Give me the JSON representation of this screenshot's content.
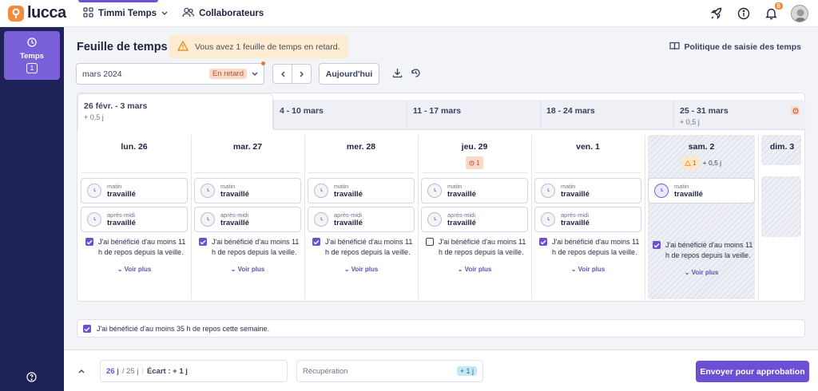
{
  "app": {
    "logo_text": "lucca",
    "module": "Timmi Temps",
    "nav_collab": "Collaborateurs",
    "notifications_count": "6",
    "brand_color": "#6d4fd6"
  },
  "sidebar": {
    "item_label": "Temps",
    "item_count": "1"
  },
  "page": {
    "title": "Feuille de temps",
    "alert": "Vous avez 1 feuille de temps en retard.",
    "policy": "Politique de saisie des temps",
    "month": "mars 2024",
    "month_status": "En retard",
    "today": "Aujourd'hui"
  },
  "weeks": [
    {
      "label": "26 févr. - 3 mars",
      "sub": "+ 0,5 j"
    },
    {
      "label": "4 - 10 mars",
      "sub": ""
    },
    {
      "label": "11 - 17 mars",
      "sub": ""
    },
    {
      "label": "18 - 24 mars",
      "sub": ""
    },
    {
      "label": "25 - 31 mars",
      "sub": "+ 0,5 j"
    }
  ],
  "days": [
    {
      "name": "lun. 26",
      "am_top": "matin",
      "am": "travaillé",
      "pm_top": "après-midi",
      "pm": "travaillé"
    },
    {
      "name": "mar. 27",
      "am_top": "matin",
      "am": "travaillé",
      "pm_top": "après-midi",
      "pm": "travaillé"
    },
    {
      "name": "mer. 28",
      "am_top": "matin",
      "am": "travaillé",
      "pm_top": "après-midi",
      "pm": "travaillé"
    },
    {
      "name": "jeu. 29",
      "chip": "1",
      "am_top": "matin",
      "am": "travaillé",
      "pm_top": "après-midi",
      "pm": "travaillé"
    },
    {
      "name": "ven. 1",
      "am_top": "matin",
      "am": "travaillé",
      "pm_top": "après-midi",
      "pm": "travaillé"
    },
    {
      "name": "sam. 2",
      "chip": "1",
      "extra": "+ 0,5 j",
      "am_top": "matin",
      "am": "travaillé"
    },
    {
      "name": "dim. 3"
    }
  ],
  "rest_text": "J'ai bénéficié d'au moins 11 h de repos depuis la veille.",
  "see_more": "Voir plus",
  "week_rest": "J'ai bénéficié d'au moins 35 h de repos cette semaine.",
  "footer": {
    "declared": "26 j",
    "expected": "/ 25 j",
    "gap": "Écart : + 1 j",
    "recovery": "Récupération",
    "recovery_value": "+ 1 j",
    "submit": "Envoyer pour approbation"
  }
}
